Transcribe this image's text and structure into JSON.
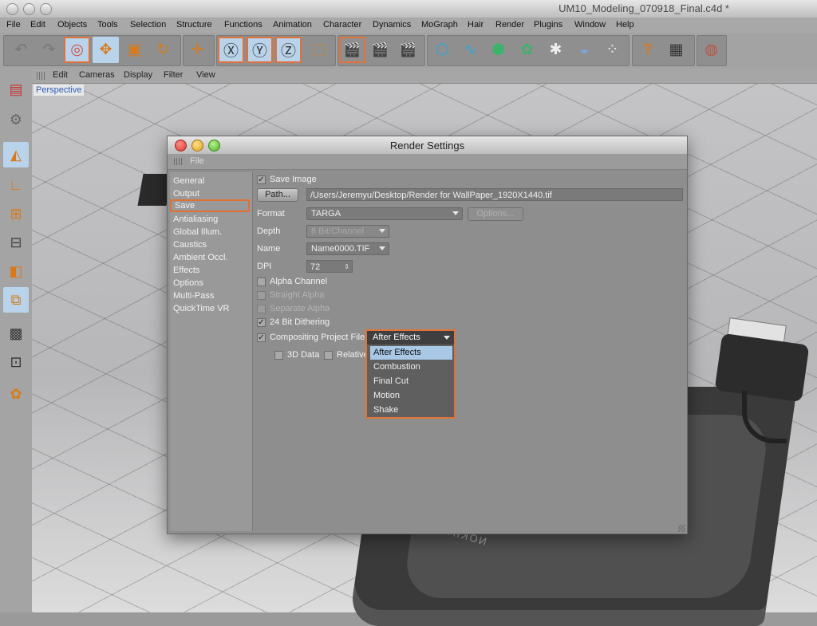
{
  "window": {
    "title": "UM10_Modeling_070918_Final.c4d *"
  },
  "menubar": [
    "File",
    "Edit",
    "Objects",
    "Tools",
    "Selection",
    "Structure",
    "Functions",
    "Animation",
    "Character",
    "Dynamics",
    "MoGraph",
    "Hair",
    "Render",
    "Plugins",
    "Window",
    "Help"
  ],
  "toolbar": {
    "icons": [
      "undo-icon",
      "redo-icon",
      "live-selection-icon",
      "move-icon",
      "scale-icon",
      "rotate-icon",
      "move-axis-icon",
      "x-axis-icon",
      "y-axis-icon",
      "z-axis-icon",
      "world-coordinates-icon",
      "render-view-icon",
      "render-picture-viewer-icon",
      "render-settings-icon",
      "cube-icon",
      "spline-pen-icon",
      "nurbs-icon",
      "array-icon",
      "deformer-icon",
      "scene-camera-icon",
      "particle-icon",
      "help-icon",
      "table-icon",
      "web-icon"
    ],
    "glyphs": [
      "↶",
      "↷",
      "◎",
      "✥",
      "▣",
      "↻",
      "✛",
      "Ⓧ",
      "Ⓨ",
      "Ⓩ",
      "⬚",
      "🎬",
      "🎬",
      "🎬",
      "⬡",
      "∿",
      "⬢",
      "✿",
      "✱",
      "◒",
      "⁘",
      "?",
      "▦",
      "◍"
    ]
  },
  "viewport_menu": [
    "Edit",
    "Cameras",
    "Display",
    "Filter",
    "View"
  ],
  "viewport": {
    "label": "Perspective",
    "brand_text": "NOKIA"
  },
  "left_tools": [
    "model-mode-icon",
    "object-mode-icon",
    "points-mode-icon",
    "edges-mode-icon",
    "polygons-mode-icon",
    "texture-mode-icon",
    "axis-mode-icon",
    "tweak-mode-icon",
    "workplane-icon",
    "uv-mode-icon",
    "snapping-icon",
    "character-icon"
  ],
  "dialog": {
    "title": "Render Settings",
    "file_menu": "File",
    "nav": [
      "General",
      "Output",
      "Save",
      "Antialiasing",
      "Global Illum.",
      "Caustics",
      "Ambient Occl.",
      "Effects",
      "Options",
      "Multi-Pass",
      "QuickTime VR"
    ],
    "active_nav": "Save",
    "save_image_label": "Save Image",
    "save_image_checked": true,
    "path_button": "Path...",
    "path_value": "/Users/Jeremyu/Desktop/Render for WallPaper_1920X1440.tif",
    "format_label": "Format",
    "format_value": "TARGA",
    "options_button": "Options...",
    "depth_label": "Depth",
    "depth_value": "8 Bit/Channel",
    "name_label": "Name",
    "name_value": "Name0000.TIF",
    "dpi_label": "DPI",
    "dpi_value": "72",
    "alpha_channel": "Alpha Channel",
    "straight_alpha": "Straight Alpha",
    "separate_alpha": "Separate Alpha",
    "dithering": "24 Bit Dithering",
    "dithering_checked": true,
    "compositing_label": "Compositing Project File",
    "compositing_checked": true,
    "compositing_value": "After Effects",
    "data_3d": "3D Data",
    "relative": "Relative",
    "dropdown_options": [
      "After Effects",
      "Combustion",
      "Final Cut",
      "Motion",
      "Shake"
    ],
    "dropdown_selected": "After Effects"
  },
  "colors": {
    "accent": "#e27235",
    "selection": "#a9c8e6",
    "panel": "#8e8e8e"
  }
}
